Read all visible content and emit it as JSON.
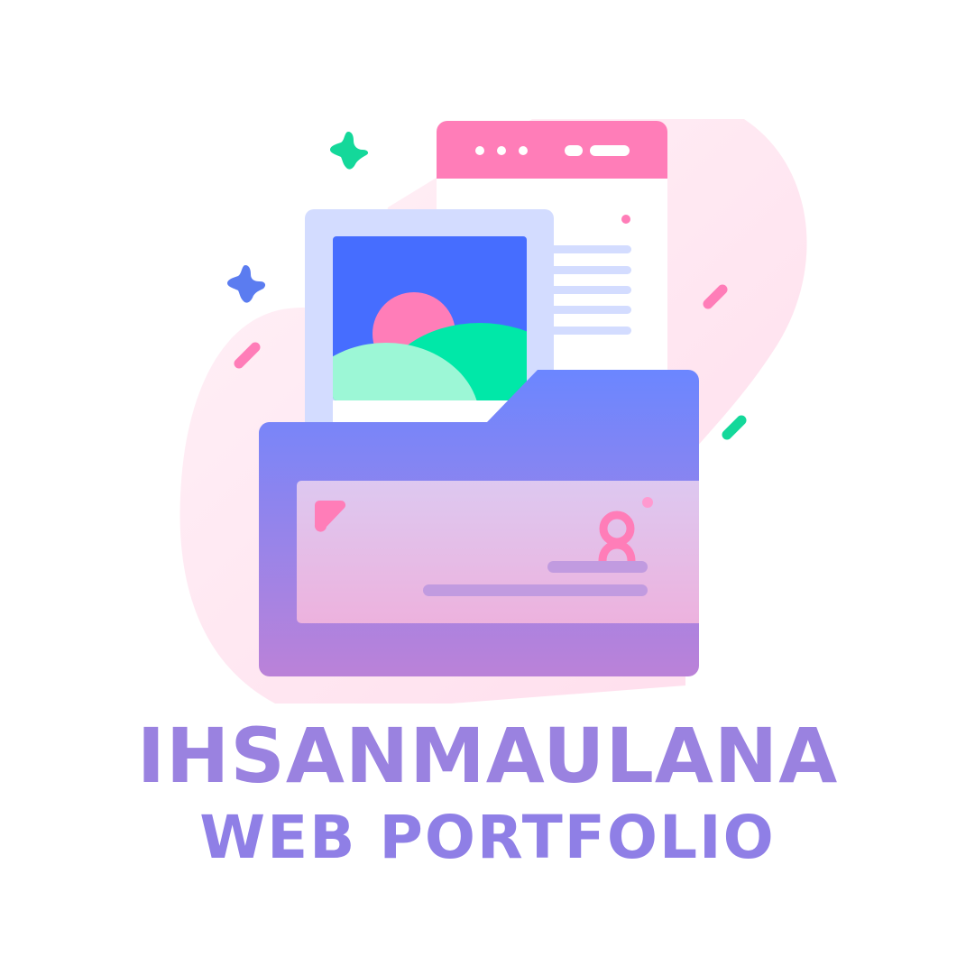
{
  "logo": {
    "title": "IHSANMAULANA",
    "subtitle": "WEB PORTFOLIO"
  },
  "icons": {
    "illustration": "folder-portfolio-illustration",
    "sparkles": "sparkle-icon",
    "image": "landscape-image-icon",
    "user": "user-icon"
  },
  "colors": {
    "pink": "#ff7db8",
    "blue": "#466dff",
    "mint": "#00e8a8",
    "lavender": "#d3dcff",
    "folder_top": "#6b86ff",
    "folder_bottom": "#bb82d8",
    "title": "#9a82e0"
  }
}
